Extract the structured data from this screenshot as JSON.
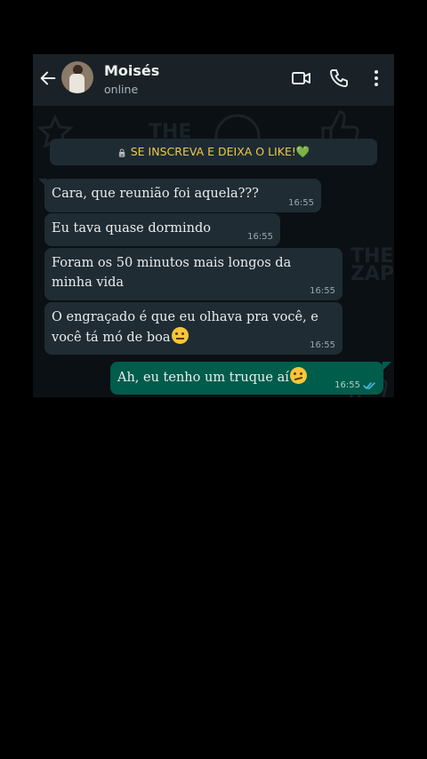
{
  "contact": {
    "name": "Moisés",
    "status": "online"
  },
  "icons": [
    "back-arrow-icon",
    "video-call-icon",
    "phone-call-icon",
    "more-vertical-icon",
    "lock-icon",
    "green-heart-icon",
    "raised-eyebrow-emoji",
    "smirk-emoji",
    "double-check-icon"
  ],
  "banner": {
    "lock": "🔒",
    "text": "SE INSCREVA E DEIXA O LIKE!",
    "heart": "💚"
  },
  "messages": [
    {
      "dir": "in",
      "text": "Cara, que reunião foi aquela???",
      "time": "16:55"
    },
    {
      "dir": "in",
      "text": "Eu tava quase dormindo",
      "time": "16:55"
    },
    {
      "dir": "in",
      "text": "Foram os 50 minutos mais longos da minha vida",
      "time": "16:55"
    },
    {
      "dir": "in",
      "text": "O engraçado é que eu olhava pra você, e você tá mó de boa",
      "time": "16:55"
    },
    {
      "dir": "out",
      "text": "Ah, eu tenho um truque aí",
      "time": "16:55"
    }
  ],
  "wallpaper_text": [
    "THE",
    "ZAP",
    "THE"
  ],
  "colors": {
    "header": "#1a2228",
    "incoming": "#1f2c33",
    "outgoing": "#005c4b",
    "banner_text": "#f1c84b",
    "read_ticks": "#53bdeb"
  }
}
